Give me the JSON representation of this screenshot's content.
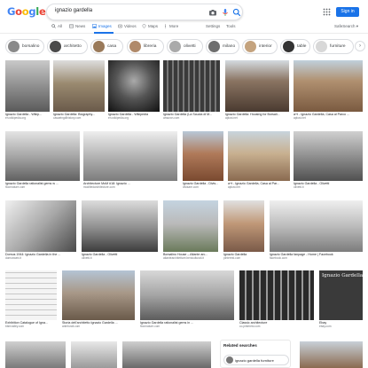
{
  "header": {
    "logo": "Google",
    "query": "ignazio gardella",
    "sign_in_label": "Sign in",
    "colors": {
      "blue": "#4285f4",
      "red": "#ea4335",
      "yellow": "#fbbc05",
      "green": "#34a853",
      "accent": "#1a73e8"
    }
  },
  "tabs": [
    {
      "label": "All",
      "icon": "search-icon",
      "active": false
    },
    {
      "label": "News",
      "icon": "news-icon",
      "active": false
    },
    {
      "label": "Images",
      "icon": "image-icon",
      "active": true
    },
    {
      "label": "Videos",
      "icon": "video-icon",
      "active": false
    },
    {
      "label": "Maps",
      "icon": "map-pin-icon",
      "active": false
    },
    {
      "label": "More",
      "icon": "more-icon",
      "active": false
    }
  ],
  "tools": {
    "settings_label": "Settings",
    "tools_label": "Tools",
    "safesearch_label": "SafeSearch ▾"
  },
  "chips": [
    {
      "label": "borsalino"
    },
    {
      "label": "architetto"
    },
    {
      "label": "casa"
    },
    {
      "label": "libreria"
    },
    {
      "label": "olivetti"
    },
    {
      "label": "milano"
    },
    {
      "label": "interior"
    },
    {
      "label": "table"
    },
    {
      "label": "furniture"
    }
  ],
  "results": [
    {
      "caption": "Ignazio Gardella - Wikip...",
      "source": "en.wikipedia.org"
    },
    {
      "caption": "Ignazio Gardella: Biography...",
      "source": "casaeingdlhistory.com"
    },
    {
      "caption": "Ignazio Gardella - Wikipedia",
      "source": "en.wikipedia.org"
    },
    {
      "caption": "Ignazio Gardella (La Scuola di M...",
      "source": "amazon.com"
    },
    {
      "caption": "Ignazio Gardella: Housing for Borsali...",
      "source": "aplust.net"
    },
    {
      "caption": "a+t - Ignazio Gardella, Casa al Parco ...",
      "source": "aplust.net"
    },
    {
      "caption": "Ignazio Gardella rationalist gems w ...",
      "source": "floornature.com"
    },
    {
      "caption": "Architecture MoM #18: Ignazio ...",
      "source": "modifiedarchitecture.com"
    },
    {
      "caption": "Ignazio Gardella - Divis...",
      "source": "divisare.com"
    },
    {
      "caption": "a+t - Ignazio Gardella, Casa al Par...",
      "source": "aplust.net"
    },
    {
      "caption": "Ignazio Gardella - Olivetti",
      "source": "olivetti.it"
    },
    {
      "caption": "Domus 1944: Ignazio Gardella in the ...",
      "source": "domusweb.it"
    },
    {
      "caption": "Ignazio Gardella - Olivetti",
      "source": "olivetti.it"
    },
    {
      "caption": "Borsalino House – Atlante arc...",
      "source": "atlantearchitetture.beniculturali.it"
    },
    {
      "caption": "Ignazio Gardella",
      "source": "pinterest.com"
    },
    {
      "caption": "Ignazio Gardella fanpage - Home | Facebook",
      "source": "facebook.com"
    },
    {
      "caption": "Exhibition Catalogue of Igna...",
      "source": "bbmvalley.com"
    },
    {
      "caption": "Storia dell'architetto Ignazio Gardella ...",
      "source": "arimfundt.com"
    },
    {
      "caption": "Ignazio Gardella rationalist gems in ...",
      "source": "floornature.com"
    },
    {
      "caption": "Classic architecture",
      "source": "co.pinterest.com"
    },
    {
      "caption": "Ebay",
      "source": "ebay.com"
    }
  ],
  "overlay_text": "Ignazio Gardella",
  "related": {
    "title": "Related searches",
    "items": [
      {
        "label": "ignazio gardella furniture"
      }
    ]
  }
}
